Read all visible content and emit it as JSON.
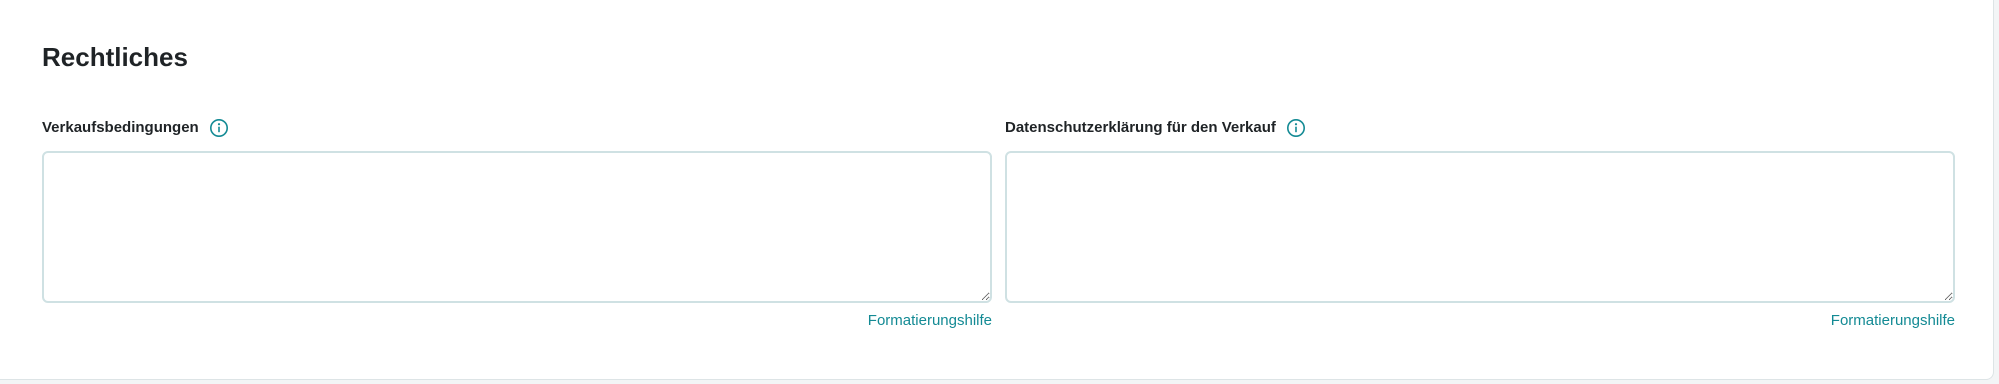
{
  "section": {
    "title": "Rechtliches"
  },
  "fields": [
    {
      "label": "Verkaufsbedingungen",
      "info_icon": "info-circle-icon",
      "value": "",
      "help_link": "Formatierungshilfe"
    },
    {
      "label": "Datenschutzerklärung für den Verkauf",
      "info_icon": "info-circle-icon",
      "value": "",
      "help_link": "Formatierungshilfe"
    }
  ],
  "colors": {
    "accent": "#138a94",
    "text": "#1f2326",
    "input_border": "#cfe1e3",
    "card_border": "#dde4e6"
  }
}
